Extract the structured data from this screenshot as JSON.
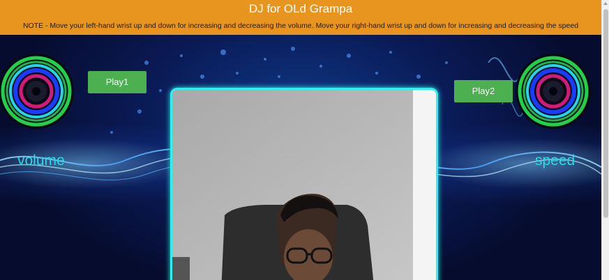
{
  "header": {
    "title": "DJ for OLd Grampa",
    "note": "NOTE - Move your left-hand wrist up and down for increasing and decreasing the volume. Move your right-hand wrist up and down for increasing and decreasing the speed"
  },
  "controls": {
    "play1_label": "Play1",
    "play2_label": "Play2",
    "volume_label": "volume",
    "speed_label": "speed"
  },
  "colors": {
    "header_bg": "#e8951f",
    "button_bg": "#4caf50",
    "accent_cyan": "#2bd9e6",
    "webcam_border": "#2ef1ee"
  }
}
